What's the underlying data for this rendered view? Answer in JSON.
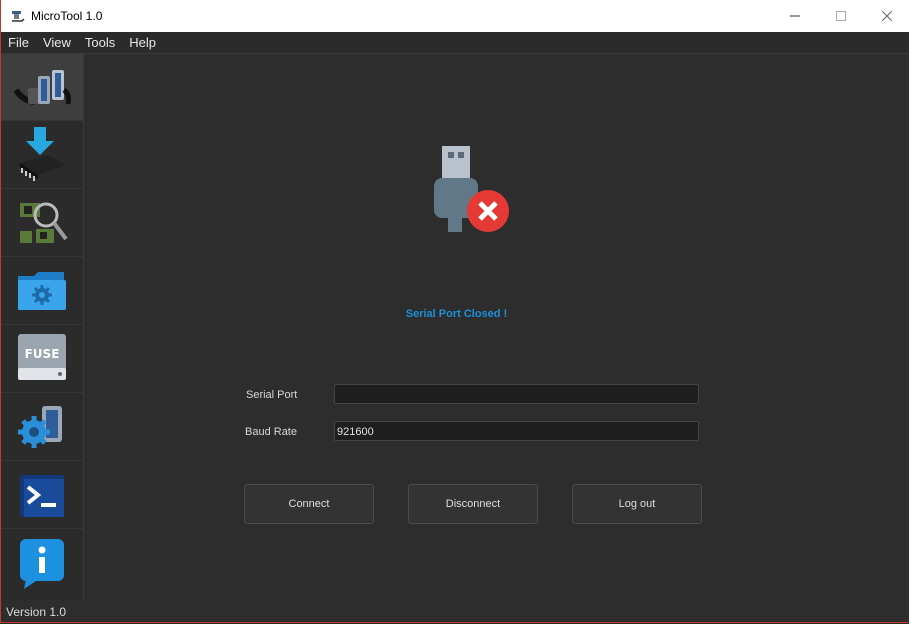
{
  "window": {
    "title": "MicroTool 1.0"
  },
  "menu": {
    "items": [
      "File",
      "View",
      "Tools",
      "Help"
    ]
  },
  "sidebar": {
    "items": [
      {
        "name": "serial-connection",
        "icon": "serial-cable-icon"
      },
      {
        "name": "download-firmware",
        "icon": "download-chip-icon"
      },
      {
        "name": "inspect-board",
        "icon": "magnifier-board-icon"
      },
      {
        "name": "settings-folder",
        "icon": "gear-folder-icon"
      },
      {
        "name": "fuse",
        "icon": "fuse-drive-icon",
        "label": "FUSE"
      },
      {
        "name": "port-settings",
        "icon": "gear-port-icon"
      },
      {
        "name": "terminal",
        "icon": "terminal-icon"
      },
      {
        "name": "info",
        "icon": "info-icon"
      }
    ],
    "version": "Version 1.0"
  },
  "main": {
    "status_text": "Serial Port Closed !",
    "status_icon": "usb-disconnected-icon",
    "serial_port_label": "Serial Port",
    "serial_port_value": "",
    "baud_rate_label": "Baud Rate",
    "baud_rate_value": "921600",
    "buttons": {
      "connect": "Connect",
      "disconnect": "Disconnect",
      "logout": "Log out"
    }
  },
  "colors": {
    "accent": "#1e90d8",
    "background": "#2d2d2d",
    "error": "#e53935"
  }
}
